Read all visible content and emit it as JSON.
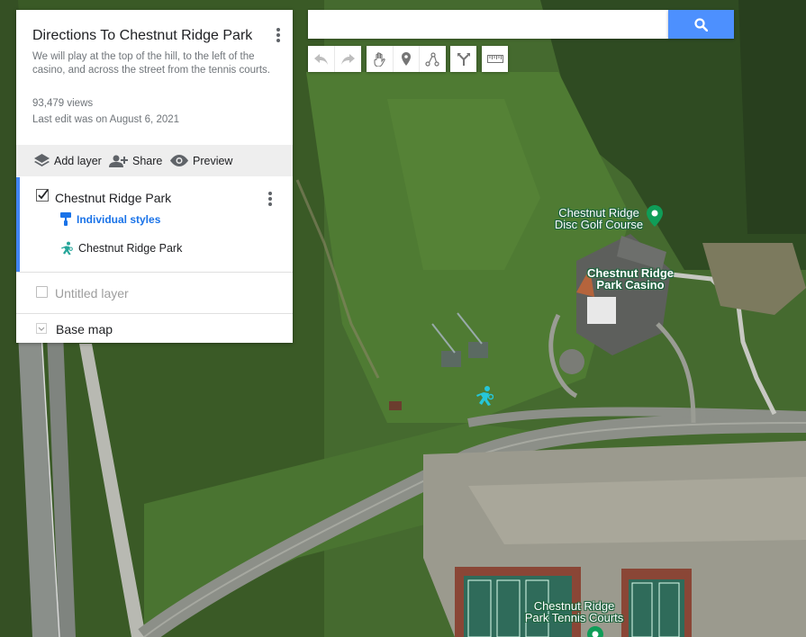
{
  "panel": {
    "title": "Directions To Chestnut Ridge Park",
    "description": "We will play at the top of the hill, to the left of the casino, and across the street from the tennis courts.",
    "views": "93,479 views",
    "last_edit": "Last edit was on August 6, 2021",
    "actions": {
      "add_layer": "Add layer",
      "share": "Share",
      "preview": "Preview"
    },
    "layers": [
      {
        "name": "Chestnut Ridge Park",
        "checked": true,
        "style_link": "Individual styles",
        "features": [
          "Chestnut Ridge Park"
        ]
      },
      {
        "name": "Untitled layer",
        "checked": false
      }
    ],
    "base_map": "Base map"
  },
  "search": {
    "value": "",
    "placeholder": ""
  },
  "toolbar": {
    "buttons": [
      "undo-icon",
      "redo-icon",
      "hand-icon",
      "add-marker-icon",
      "draw-line-icon",
      "directions-icon",
      "ruler-icon"
    ]
  },
  "map": {
    "labels": {
      "disc_golf": [
        "Chestnut Ridge",
        "Disc Golf Course"
      ],
      "casino": [
        "Chestnut Ridge",
        "Park Casino"
      ],
      "tennis": [
        "Chestnut Ridge",
        "Park Tennis Courts"
      ]
    }
  },
  "colors": {
    "accent": "#4285f4",
    "search_button": "#4d90fe",
    "marker_green": "#0f9d58",
    "feature_icon": "#26a69a"
  }
}
